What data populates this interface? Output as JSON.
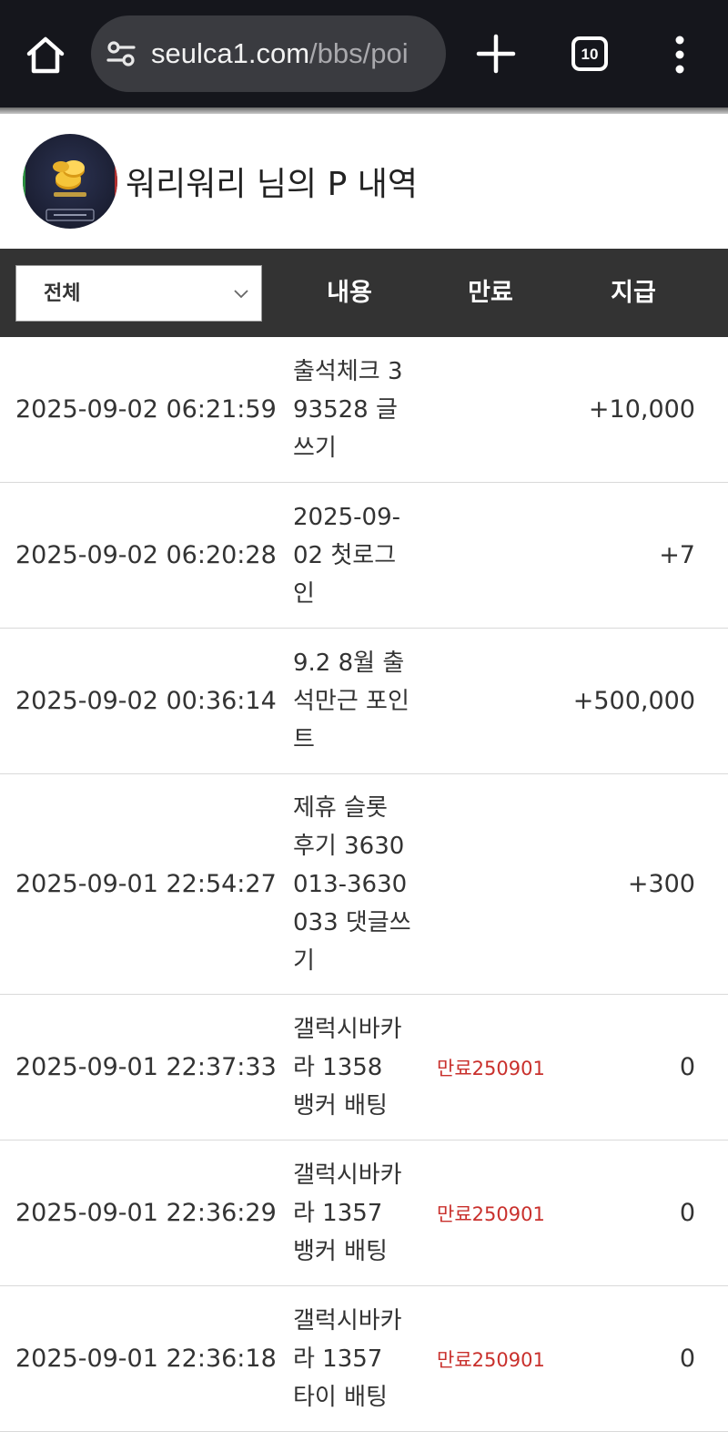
{
  "browser": {
    "url_host": "seulca1.com",
    "url_path": "/bbs/poi",
    "tab_count": "10"
  },
  "header": {
    "title": "워리워리 님의 P 내역"
  },
  "table": {
    "filter_value": "전체",
    "columns": {
      "content": "내용",
      "expire": "만료",
      "grant": "지급"
    },
    "rows": [
      {
        "date": "2025-09-02 06:21:59",
        "content": "출석체크 393528 글쓰기",
        "expire": "",
        "amount": "+10,000",
        "height": 160
      },
      {
        "date": "2025-09-02 06:20:28",
        "content": "2025-09-02 첫로그인",
        "expire": "",
        "amount": "+7",
        "height": 160
      },
      {
        "date": "2025-09-02 00:36:14",
        "content": "9.2 8월 출석만근 포인트",
        "expire": "",
        "amount": "+500,000",
        "height": 160
      },
      {
        "date": "2025-09-01 22:54:27",
        "content": "제휴 슬롯 후기 3630013-3630033 댓글쓰기",
        "expire": "",
        "amount": "+300",
        "height": 242
      },
      {
        "date": "2025-09-01 22:37:33",
        "content": "갤럭시바카라 1358 뱅커 배팅",
        "expire": "만료250901",
        "amount": "0",
        "height": 160
      },
      {
        "date": "2025-09-01 22:36:29",
        "content": "갤럭시바카라 1357 뱅커 배팅",
        "expire": "만료250901",
        "amount": "0",
        "height": 160
      },
      {
        "date": "2025-09-01 22:36:18",
        "content": "갤럭시바카라 1357 타이 배팅",
        "expire": "만료250901",
        "amount": "0",
        "height": 160
      }
    ]
  },
  "colors": {
    "topbar": "#15161c",
    "header_bg": "#333333",
    "expire_text": "#c9302c"
  },
  "icons": [
    "home-icon",
    "site-settings-icon",
    "plus-icon",
    "tab-switcher-icon",
    "more-vert-icon",
    "chevron-down-icon"
  ]
}
